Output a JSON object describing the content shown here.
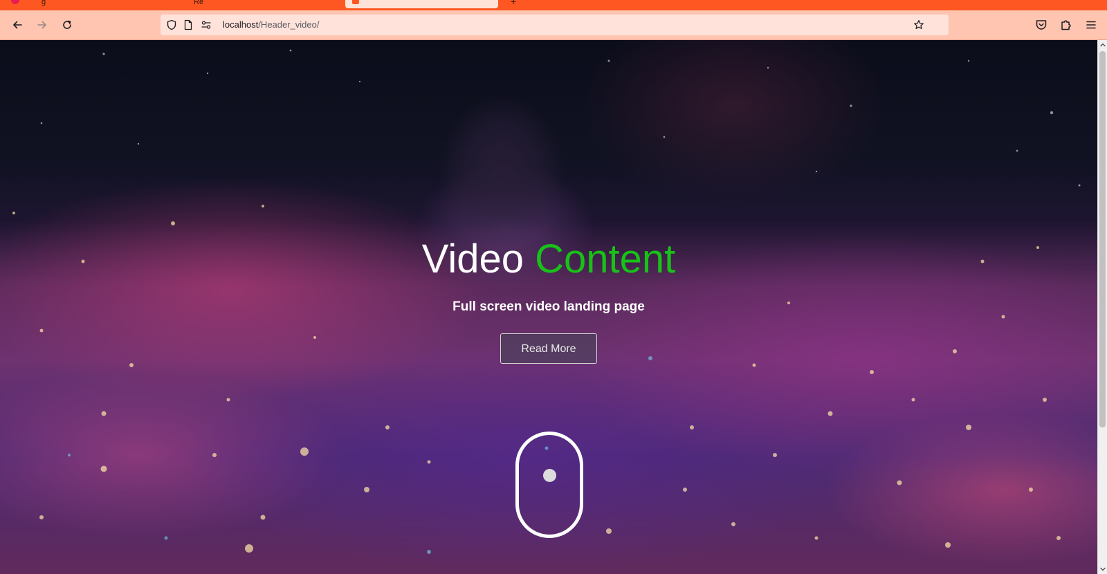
{
  "browser": {
    "tabs_partial": [
      "g",
      "Re"
    ],
    "url_host": "localhost",
    "url_path": "/Header_video/"
  },
  "hero": {
    "title_main": "Video",
    "title_accent": "Content",
    "subtitle": "Full screen video landing page",
    "button_label": "Read More"
  },
  "icons": {
    "back": "arrow-left-icon",
    "forward": "arrow-right-icon",
    "reload": "reload-icon",
    "shield": "shield-icon",
    "page": "page-icon",
    "permissions": "permissions-icon",
    "bookmark": "star-icon",
    "pocket": "pocket-icon",
    "extensions": "puzzle-icon",
    "menu": "hamburger-menu-icon",
    "scroll_indicator": "mouse-icon"
  },
  "colors": {
    "tabstrip": "#ff5722",
    "toolbar": "#ffc5b0",
    "title_accent": "#18c118",
    "title": "#ffffff"
  }
}
